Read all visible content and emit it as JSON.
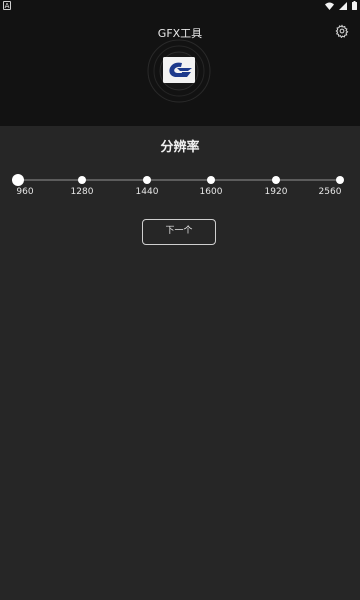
{
  "status_bar": {
    "left_icon_text": "A"
  },
  "header": {
    "title": "GFX工具"
  },
  "main": {
    "section_title": "分辨率",
    "slider": {
      "options": [
        "960",
        "1280",
        "1440",
        "1600",
        "1920",
        "2560"
      ],
      "selected": "960"
    },
    "next_button_label": "下一个"
  },
  "colors": {
    "header_bg": "#121212",
    "content_bg": "#262626",
    "track": "#5c5c5c",
    "dot": "#ffffff",
    "logo_blue": "#1d3a8c"
  },
  "icons": [
    "settings-icon",
    "app-logo",
    "wifi-icon",
    "battery-icon"
  ]
}
